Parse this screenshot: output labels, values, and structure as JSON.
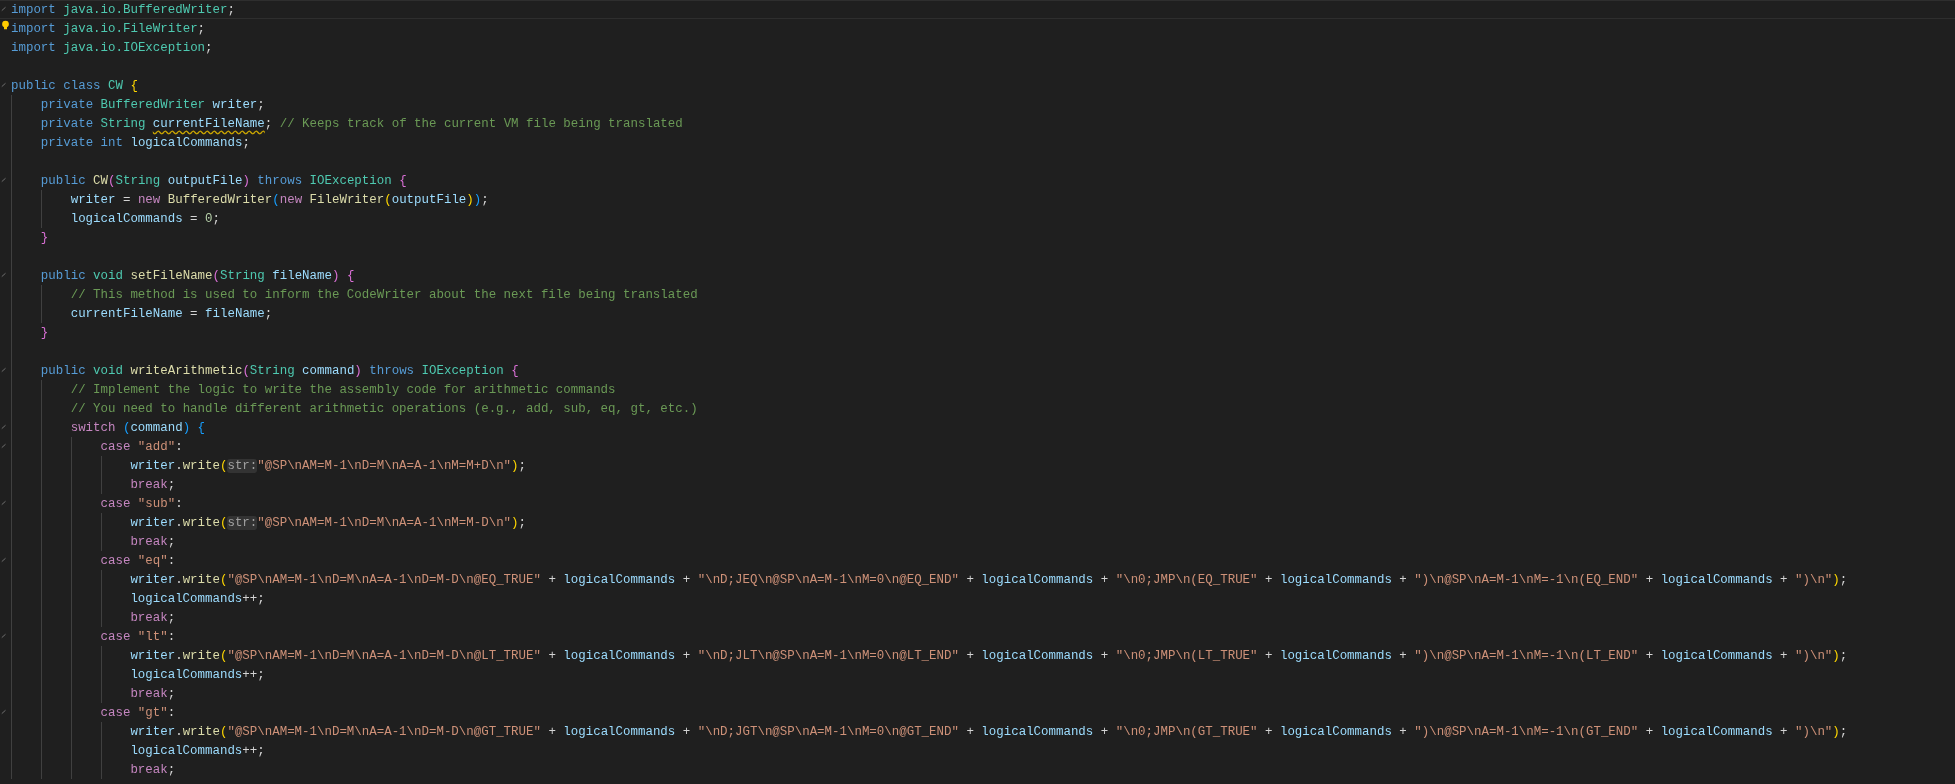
{
  "lines": [
    {
      "kind": "code",
      "current": true,
      "foldable": true,
      "tokens": [
        {
          "kind": "kw",
          "text": "import "
        },
        {
          "kind": "type",
          "text": "java.io.BufferedWriter"
        },
        {
          "kind": "op",
          "text": ";"
        }
      ]
    },
    {
      "kind": "code",
      "lightbulb": true,
      "tokens": [
        {
          "kind": "kw",
          "text": "import "
        },
        {
          "kind": "type",
          "text": "java.io.FileWriter"
        },
        {
          "kind": "op",
          "text": ";"
        }
      ]
    },
    {
      "kind": "code",
      "tokens": [
        {
          "kind": "kw",
          "text": "import "
        },
        {
          "kind": "type",
          "text": "java.io.IOException"
        },
        {
          "kind": "op",
          "text": ";"
        }
      ]
    },
    {
      "kind": "blank"
    },
    {
      "kind": "code",
      "tokens": [
        {
          "kind": "kw",
          "text": "public class "
        },
        {
          "kind": "type",
          "text": "CW "
        },
        {
          "kind": "b1",
          "text": "{"
        }
      ],
      "children": [
        {
          "kind": "code",
          "tokens": [
            {
              "kind": "kw",
              "text": "private "
            },
            {
              "kind": "type",
              "text": "BufferedWriter "
            },
            {
              "kind": "var",
              "text": "writer"
            },
            {
              "kind": "op",
              "text": ";"
            }
          ]
        },
        {
          "kind": "code",
          "tokens": [
            {
              "kind": "kw",
              "text": "private "
            },
            {
              "kind": "type",
              "text": "String "
            },
            {
              "kind": "var",
              "text": "currentFileName",
              "warning": true
            },
            {
              "kind": "op",
              "text": "; "
            },
            {
              "kind": "cmt",
              "text": "// Keeps track of the current VM file being translated"
            }
          ]
        },
        {
          "kind": "code",
          "tokens": [
            {
              "kind": "kw",
              "text": "private "
            },
            {
              "kind": "kw",
              "text": "int "
            },
            {
              "kind": "var",
              "text": "logicalCommands"
            },
            {
              "kind": "op",
              "text": ";"
            }
          ]
        },
        {
          "kind": "blank"
        },
        {
          "kind": "code",
          "tokens": [
            {
              "kind": "kw",
              "text": "public "
            },
            {
              "kind": "fn",
              "text": "CW"
            },
            {
              "kind": "b2",
              "text": "("
            },
            {
              "kind": "type",
              "text": "String "
            },
            {
              "kind": "var",
              "text": "outputFile"
            },
            {
              "kind": "b2",
              "text": ")"
            },
            {
              "kind": "kw",
              "text": " throws "
            },
            {
              "kind": "type",
              "text": "IOException "
            },
            {
              "kind": "b2",
              "text": "{"
            }
          ],
          "children": [
            {
              "kind": "code",
              "tokens": [
                {
                  "kind": "var",
                  "text": "writer"
                },
                {
                  "kind": "op",
                  "text": " = "
                },
                {
                  "kind": "ctrl",
                  "text": "new "
                },
                {
                  "kind": "fn",
                  "text": "BufferedWriter"
                },
                {
                  "kind": "b3",
                  "text": "("
                },
                {
                  "kind": "ctrl",
                  "text": "new "
                },
                {
                  "kind": "fn",
                  "text": "FileWriter"
                },
                {
                  "kind": "b1",
                  "text": "("
                },
                {
                  "kind": "var",
                  "text": "outputFile"
                },
                {
                  "kind": "b1",
                  "text": ")"
                },
                {
                  "kind": "b3",
                  "text": ")"
                },
                {
                  "kind": "op",
                  "text": ";"
                }
              ]
            },
            {
              "kind": "code",
              "tokens": [
                {
                  "kind": "var",
                  "text": "logicalCommands"
                },
                {
                  "kind": "op",
                  "text": " = "
                },
                {
                  "kind": "num",
                  "text": "0"
                },
                {
                  "kind": "op",
                  "text": ";"
                }
              ]
            }
          ]
        },
        {
          "kind": "code",
          "tokens": [
            {
              "kind": "b2",
              "text": "}"
            }
          ]
        },
        {
          "kind": "blank"
        },
        {
          "kind": "code",
          "tokens": [
            {
              "kind": "kw",
              "text": "public "
            },
            {
              "kind": "type",
              "text": "void "
            },
            {
              "kind": "fn",
              "text": "setFileName"
            },
            {
              "kind": "b2",
              "text": "("
            },
            {
              "kind": "type",
              "text": "String "
            },
            {
              "kind": "var",
              "text": "fileName"
            },
            {
              "kind": "b2",
              "text": ") {"
            }
          ],
          "children": [
            {
              "kind": "code",
              "tokens": [
                {
                  "kind": "cmt",
                  "text": "// This method is used to inform the CodeWriter about the next file being translated"
                }
              ]
            },
            {
              "kind": "code",
              "tokens": [
                {
                  "kind": "var",
                  "text": "currentFileName"
                },
                {
                  "kind": "op",
                  "text": " = "
                },
                {
                  "kind": "var",
                  "text": "fileName"
                },
                {
                  "kind": "op",
                  "text": ";"
                }
              ]
            }
          ]
        },
        {
          "kind": "code",
          "tokens": [
            {
              "kind": "b2",
              "text": "}"
            }
          ]
        },
        {
          "kind": "blank"
        },
        {
          "kind": "code",
          "tokens": [
            {
              "kind": "kw",
              "text": "public "
            },
            {
              "kind": "type",
              "text": "void "
            },
            {
              "kind": "fn",
              "text": "writeArithmetic"
            },
            {
              "kind": "b2",
              "text": "("
            },
            {
              "kind": "type",
              "text": "String "
            },
            {
              "kind": "var",
              "text": "command"
            },
            {
              "kind": "b2",
              "text": ")"
            },
            {
              "kind": "kw",
              "text": " throws "
            },
            {
              "kind": "type",
              "text": "IOException "
            },
            {
              "kind": "b2",
              "text": "{"
            }
          ],
          "children": [
            {
              "kind": "code",
              "tokens": [
                {
                  "kind": "cmt",
                  "text": "// Implement the logic to write the assembly code for arithmetic commands"
                }
              ]
            },
            {
              "kind": "code",
              "tokens": [
                {
                  "kind": "cmt",
                  "text": "// You need to handle different arithmetic operations (e.g., add, sub, eq, gt, etc.)"
                }
              ]
            },
            {
              "kind": "code",
              "tokens": [
                {
                  "kind": "ctrl",
                  "text": "switch "
                },
                {
                  "kind": "b3",
                  "text": "("
                },
                {
                  "kind": "var",
                  "text": "command"
                },
                {
                  "kind": "b3",
                  "text": ") {"
                }
              ],
              "children": [
                {
                  "kind": "code",
                  "tokens": [
                    {
                      "kind": "ctrl",
                      "text": "case "
                    },
                    {
                      "kind": "str",
                      "text": "\"add\""
                    },
                    {
                      "kind": "op",
                      "text": ":"
                    }
                  ],
                  "children": [
                    {
                      "kind": "code",
                      "tokens": [
                        {
                          "kind": "var",
                          "text": "writer"
                        },
                        {
                          "kind": "op",
                          "text": "."
                        },
                        {
                          "kind": "fn",
                          "text": "write"
                        },
                        {
                          "kind": "b1",
                          "text": "("
                        },
                        {
                          "kind": "hint",
                          "text": "str:"
                        },
                        {
                          "kind": "str",
                          "text": "\"@SP\\nAM=M-1\\nD=M\\nA=A-1\\nM=M+D\\n\""
                        },
                        {
                          "kind": "b1",
                          "text": ")"
                        },
                        {
                          "kind": "op",
                          "text": ";"
                        }
                      ]
                    },
                    {
                      "kind": "code",
                      "tokens": [
                        {
                          "kind": "ctrl",
                          "text": "break"
                        },
                        {
                          "kind": "op",
                          "text": ";"
                        }
                      ]
                    }
                  ]
                },
                {
                  "kind": "code",
                  "tokens": [
                    {
                      "kind": "ctrl",
                      "text": "case "
                    },
                    {
                      "kind": "str",
                      "text": "\"sub\""
                    },
                    {
                      "kind": "op",
                      "text": ":"
                    }
                  ],
                  "children": [
                    {
                      "kind": "code",
                      "tokens": [
                        {
                          "kind": "var",
                          "text": "writer"
                        },
                        {
                          "kind": "op",
                          "text": "."
                        },
                        {
                          "kind": "fn",
                          "text": "write"
                        },
                        {
                          "kind": "b1",
                          "text": "("
                        },
                        {
                          "kind": "hint",
                          "text": "str:"
                        },
                        {
                          "kind": "str",
                          "text": "\"@SP\\nAM=M-1\\nD=M\\nA=A-1\\nM=M-D\\n\""
                        },
                        {
                          "kind": "b1",
                          "text": ")"
                        },
                        {
                          "kind": "op",
                          "text": ";"
                        }
                      ]
                    },
                    {
                      "kind": "code",
                      "tokens": [
                        {
                          "kind": "ctrl",
                          "text": "break"
                        },
                        {
                          "kind": "op",
                          "text": ";"
                        }
                      ]
                    }
                  ]
                },
                {
                  "kind": "code",
                  "tokens": [
                    {
                      "kind": "ctrl",
                      "text": "case "
                    },
                    {
                      "kind": "str",
                      "text": "\"eq\""
                    },
                    {
                      "kind": "op",
                      "text": ":"
                    }
                  ],
                  "children": [
                    {
                      "kind": "code",
                      "tokens": [
                        {
                          "kind": "var",
                          "text": "writer"
                        },
                        {
                          "kind": "op",
                          "text": "."
                        },
                        {
                          "kind": "fn",
                          "text": "write"
                        },
                        {
                          "kind": "b1",
                          "text": "("
                        },
                        {
                          "kind": "str",
                          "text": "\"@SP\\nAM=M-1\\nD=M\\nA=A-1\\nD=M-D\\n@EQ_TRUE\""
                        },
                        {
                          "kind": "op",
                          "text": " + "
                        },
                        {
                          "kind": "var",
                          "text": "logicalCommands"
                        },
                        {
                          "kind": "op",
                          "text": " + "
                        },
                        {
                          "kind": "str",
                          "text": "\"\\nD;JEQ\\n@SP\\nA=M-1\\nM=0\\n@EQ_END\""
                        },
                        {
                          "kind": "op",
                          "text": " + "
                        },
                        {
                          "kind": "var",
                          "text": "logicalCommands"
                        },
                        {
                          "kind": "op",
                          "text": " + "
                        },
                        {
                          "kind": "str",
                          "text": "\"\\n0;JMP\\n(EQ_TRUE\""
                        },
                        {
                          "kind": "op",
                          "text": " + "
                        },
                        {
                          "kind": "var",
                          "text": "logicalCommands"
                        },
                        {
                          "kind": "op",
                          "text": " + "
                        },
                        {
                          "kind": "str",
                          "text": "\")\\n@SP\\nA=M-1\\nM=-1\\n(EQ_END\""
                        },
                        {
                          "kind": "op",
                          "text": " + "
                        },
                        {
                          "kind": "var",
                          "text": "logicalCommands"
                        },
                        {
                          "kind": "op",
                          "text": " + "
                        },
                        {
                          "kind": "str",
                          "text": "\")\\n\""
                        },
                        {
                          "kind": "b1",
                          "text": ")"
                        },
                        {
                          "kind": "op",
                          "text": ";"
                        }
                      ]
                    },
                    {
                      "kind": "code",
                      "tokens": [
                        {
                          "kind": "var",
                          "text": "logicalCommands"
                        },
                        {
                          "kind": "op",
                          "text": "++;"
                        }
                      ]
                    },
                    {
                      "kind": "code",
                      "tokens": [
                        {
                          "kind": "ctrl",
                          "text": "break"
                        },
                        {
                          "kind": "op",
                          "text": ";"
                        }
                      ]
                    }
                  ]
                },
                {
                  "kind": "code",
                  "tokens": [
                    {
                      "kind": "ctrl",
                      "text": "case "
                    },
                    {
                      "kind": "str",
                      "text": "\"lt\""
                    },
                    {
                      "kind": "op",
                      "text": ":"
                    }
                  ],
                  "children": [
                    {
                      "kind": "code",
                      "tokens": [
                        {
                          "kind": "var",
                          "text": "writer"
                        },
                        {
                          "kind": "op",
                          "text": "."
                        },
                        {
                          "kind": "fn",
                          "text": "write"
                        },
                        {
                          "kind": "b1",
                          "text": "("
                        },
                        {
                          "kind": "str",
                          "text": "\"@SP\\nAM=M-1\\nD=M\\nA=A-1\\nD=M-D\\n@LT_TRUE\""
                        },
                        {
                          "kind": "op",
                          "text": " + "
                        },
                        {
                          "kind": "var",
                          "text": "logicalCommands"
                        },
                        {
                          "kind": "op",
                          "text": " + "
                        },
                        {
                          "kind": "str",
                          "text": "\"\\nD;JLT\\n@SP\\nA=M-1\\nM=0\\n@LT_END\""
                        },
                        {
                          "kind": "op",
                          "text": " + "
                        },
                        {
                          "kind": "var",
                          "text": "logicalCommands"
                        },
                        {
                          "kind": "op",
                          "text": " + "
                        },
                        {
                          "kind": "str",
                          "text": "\"\\n0;JMP\\n(LT_TRUE\""
                        },
                        {
                          "kind": "op",
                          "text": " + "
                        },
                        {
                          "kind": "var",
                          "text": "logicalCommands"
                        },
                        {
                          "kind": "op",
                          "text": " + "
                        },
                        {
                          "kind": "str",
                          "text": "\")\\n@SP\\nA=M-1\\nM=-1\\n(LT_END\""
                        },
                        {
                          "kind": "op",
                          "text": " + "
                        },
                        {
                          "kind": "var",
                          "text": "logicalCommands"
                        },
                        {
                          "kind": "op",
                          "text": " + "
                        },
                        {
                          "kind": "str",
                          "text": "\")\\n\""
                        },
                        {
                          "kind": "b1",
                          "text": ")"
                        },
                        {
                          "kind": "op",
                          "text": ";"
                        }
                      ]
                    },
                    {
                      "kind": "code",
                      "tokens": [
                        {
                          "kind": "var",
                          "text": "logicalCommands"
                        },
                        {
                          "kind": "op",
                          "text": "++;"
                        }
                      ]
                    },
                    {
                      "kind": "code",
                      "tokens": [
                        {
                          "kind": "ctrl",
                          "text": "break"
                        },
                        {
                          "kind": "op",
                          "text": ";"
                        }
                      ]
                    }
                  ]
                },
                {
                  "kind": "code",
                  "tokens": [
                    {
                      "kind": "ctrl",
                      "text": "case "
                    },
                    {
                      "kind": "str",
                      "text": "\"gt\""
                    },
                    {
                      "kind": "op",
                      "text": ":"
                    }
                  ],
                  "children": [
                    {
                      "kind": "code",
                      "tokens": [
                        {
                          "kind": "var",
                          "text": "writer"
                        },
                        {
                          "kind": "op",
                          "text": "."
                        },
                        {
                          "kind": "fn",
                          "text": "write"
                        },
                        {
                          "kind": "b1",
                          "text": "("
                        },
                        {
                          "kind": "str",
                          "text": "\"@SP\\nAM=M-1\\nD=M\\nA=A-1\\nD=M-D\\n@GT_TRUE\""
                        },
                        {
                          "kind": "op",
                          "text": " + "
                        },
                        {
                          "kind": "var",
                          "text": "logicalCommands"
                        },
                        {
                          "kind": "op",
                          "text": " + "
                        },
                        {
                          "kind": "str",
                          "text": "\"\\nD;JGT\\n@SP\\nA=M-1\\nM=0\\n@GT_END\""
                        },
                        {
                          "kind": "op",
                          "text": " + "
                        },
                        {
                          "kind": "var",
                          "text": "logicalCommands"
                        },
                        {
                          "kind": "op",
                          "text": " + "
                        },
                        {
                          "kind": "str",
                          "text": "\"\\n0;JMP\\n(GT_TRUE\""
                        },
                        {
                          "kind": "op",
                          "text": " + "
                        },
                        {
                          "kind": "var",
                          "text": "logicalCommands"
                        },
                        {
                          "kind": "op",
                          "text": " + "
                        },
                        {
                          "kind": "str",
                          "text": "\")\\n@SP\\nA=M-1\\nM=-1\\n(GT_END\""
                        },
                        {
                          "kind": "op",
                          "text": " + "
                        },
                        {
                          "kind": "var",
                          "text": "logicalCommands"
                        },
                        {
                          "kind": "op",
                          "text": " + "
                        },
                        {
                          "kind": "str",
                          "text": "\")\\n\""
                        },
                        {
                          "kind": "b1",
                          "text": ")"
                        },
                        {
                          "kind": "op",
                          "text": ";"
                        }
                      ]
                    },
                    {
                      "kind": "code",
                      "tokens": [
                        {
                          "kind": "var",
                          "text": "logicalCommands"
                        },
                        {
                          "kind": "op",
                          "text": "++;"
                        }
                      ]
                    },
                    {
                      "kind": "code",
                      "tokens": [
                        {
                          "kind": "ctrl",
                          "text": "break"
                        },
                        {
                          "kind": "op",
                          "text": ";"
                        }
                      ]
                    }
                  ]
                }
              ]
            }
          ]
        }
      ]
    }
  ]
}
